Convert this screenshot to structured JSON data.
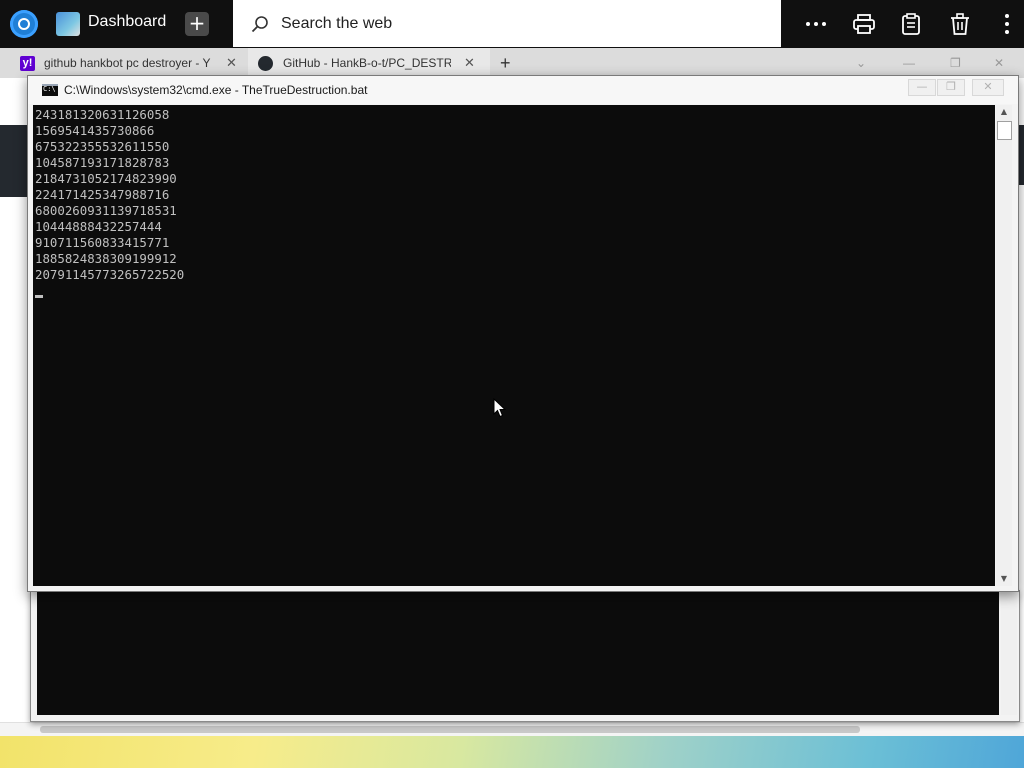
{
  "taskbar": {
    "dashboard_label": "Dashboard",
    "search_placeholder": "Search the web",
    "icons": {
      "app": "app-launcher-icon",
      "dashboard": "dashboard-icon",
      "new": "plus-icon",
      "search": "search-icon",
      "more": "ellipsis-icon",
      "print": "printer-icon",
      "clipboard": "clipboard-icon",
      "delete": "trash-icon",
      "menu": "kebab-menu-icon"
    }
  },
  "browser": {
    "tabs": [
      {
        "label": "github hankbot pc destroyer - Y",
        "favicon": "yahoo-icon",
        "favicon_color": "#6001d2"
      },
      {
        "label": "GitHub - HankB-o-t/PC_DESTRO",
        "favicon": "github-icon",
        "favicon_color": "#24292f"
      }
    ],
    "new_tab_label": "+"
  },
  "console": {
    "title": "C:\\Windows\\system32\\cmd.exe - TheTrueDestruction.bat",
    "lines": [
      "243181320631126058",
      "1569541435730866",
      "675322355532611550",
      "104587193171828783",
      "2184731052174823990",
      "224171425347988716",
      "6800260931139718531",
      "10444888432257444",
      "910711560833415771",
      "1885824838309199912",
      "20791145773265722520"
    ],
    "colors": {
      "background": "#0c0c0c",
      "text": "#c0c0c0"
    }
  }
}
